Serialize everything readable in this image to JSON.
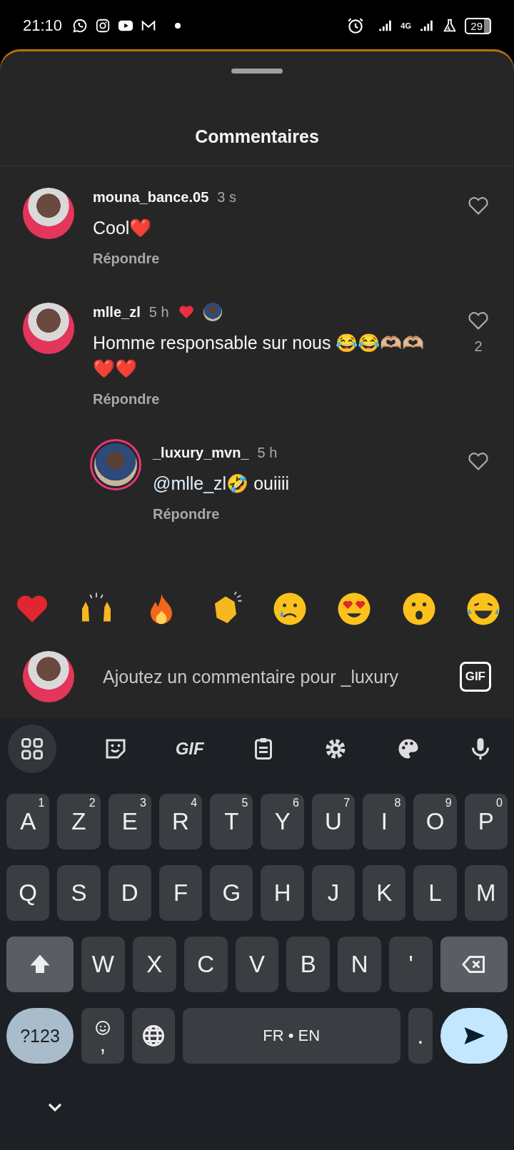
{
  "status_bar": {
    "time": "21:10",
    "network": "4G",
    "battery": "29"
  },
  "sheet": {
    "title": "Commentaires"
  },
  "comments": [
    {
      "username": "mouna_bance.05",
      "time": "3 s",
      "text": "Cool❤️",
      "reply_label": "Répondre",
      "liked": false
    },
    {
      "username": "mlle_zl",
      "time": "5 h",
      "text": "Homme responsable sur nous 😂😂🫶🏼🫶🏼❤️❤️",
      "reply_label": "Répondre",
      "liked": false,
      "like_count": "2",
      "liked_by_author": true,
      "children": [
        {
          "username": "_luxury_mvn_",
          "time": "5 h",
          "mention": "@mlle_zl",
          "text": "🤣 ouiiii",
          "reply_label": "Répondre",
          "liked": false,
          "story_ring": true
        }
      ]
    }
  ],
  "composer": {
    "placeholder": "Ajoutez un commentaire pour _luxury",
    "gif_label": "GIF"
  },
  "keyboard": {
    "toolbar_gif": "GIF",
    "rows": [
      {
        "keys": [
          {
            "kind": "char",
            "label": "A",
            "hint": "1"
          },
          {
            "kind": "char",
            "label": "Z",
            "hint": "2"
          },
          {
            "kind": "char",
            "label": "E",
            "hint": "3"
          },
          {
            "kind": "char",
            "label": "R",
            "hint": "4"
          },
          {
            "kind": "char",
            "label": "T",
            "hint": "5"
          },
          {
            "kind": "char",
            "label": "Y",
            "hint": "6"
          },
          {
            "kind": "char",
            "label": "U",
            "hint": "7"
          },
          {
            "kind": "char",
            "label": "I",
            "hint": "8"
          },
          {
            "kind": "char",
            "label": "O",
            "hint": "9"
          },
          {
            "kind": "char",
            "label": "P",
            "hint": "0"
          }
        ]
      },
      {
        "keys": [
          {
            "kind": "char",
            "label": "Q"
          },
          {
            "kind": "char",
            "label": "S"
          },
          {
            "kind": "char",
            "label": "D"
          },
          {
            "kind": "char",
            "label": "F"
          },
          {
            "kind": "char",
            "label": "G"
          },
          {
            "kind": "char",
            "label": "H"
          },
          {
            "kind": "char",
            "label": "J"
          },
          {
            "kind": "char",
            "label": "K"
          },
          {
            "kind": "char",
            "label": "L"
          },
          {
            "kind": "char",
            "label": "M"
          }
        ]
      },
      {
        "keys": [
          {
            "kind": "shift"
          },
          {
            "kind": "char",
            "label": "W"
          },
          {
            "kind": "char",
            "label": "X"
          },
          {
            "kind": "char",
            "label": "C"
          },
          {
            "kind": "char",
            "label": "V"
          },
          {
            "kind": "char",
            "label": "B"
          },
          {
            "kind": "char",
            "label": "N"
          },
          {
            "kind": "char",
            "label": "'"
          },
          {
            "kind": "backspace"
          }
        ]
      },
      {
        "keys": [
          {
            "kind": "mode",
            "label": "?123"
          },
          {
            "kind": "emoji",
            "label": ","
          },
          {
            "kind": "globe"
          },
          {
            "kind": "space",
            "label": "FR • EN"
          },
          {
            "kind": "char",
            "label": "."
          },
          {
            "kind": "send"
          }
        ]
      }
    ]
  }
}
